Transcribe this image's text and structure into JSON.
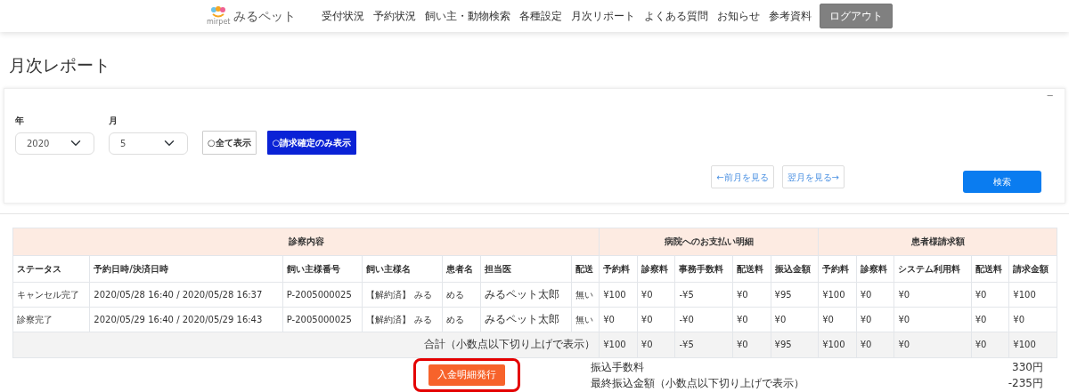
{
  "header": {
    "logo_text": "みるペット",
    "logo_sub": "mirpet",
    "nav": [
      {
        "label": "受付状況"
      },
      {
        "label": "予約状況"
      },
      {
        "label": "飼い主・動物検索"
      },
      {
        "label": "各種設定"
      },
      {
        "label": "月次リポート"
      },
      {
        "label": "よくある質問"
      },
      {
        "label": "お知らせ"
      },
      {
        "label": "参考資料"
      }
    ],
    "logout": "ログアウト"
  },
  "page_title": "月次レポート",
  "filter": {
    "collapse": "−",
    "year_label": "年",
    "year": "2020",
    "month_label": "月",
    "month": "5",
    "modes": [
      {
        "label": "○全て表示",
        "selected": false
      },
      {
        "label": "○請求確定のみ表示",
        "selected": true
      }
    ],
    "prev": "←前月を見る",
    "next": "翌月を見る→",
    "search": "検索"
  },
  "table": {
    "groups": [
      {
        "label": "診察内容"
      },
      {
        "label": "病院へのお支払い明細"
      },
      {
        "label": "患者様請求額"
      }
    ],
    "columns": [
      "ステータス",
      "予約日時/決済日時",
      "飼い主様番号",
      "飼い主様名",
      "患者名",
      "担当医",
      "配送",
      "予約料",
      "診察料",
      "事務手数料",
      "配送料",
      "振込金額",
      "予約料",
      "診察料",
      "システム利用料",
      "配送料",
      "請求金額"
    ],
    "rows": [
      [
        "キャンセル完了",
        "2020/05/28 16:40 / 2020/05/28 16:37",
        "P-2005000025",
        "【解約済】 みる",
        "める",
        "みるペット太郎",
        "無い",
        "¥100",
        "¥0",
        "-¥5",
        "¥0",
        "¥95",
        "¥100",
        "¥0",
        "¥0",
        "¥0",
        "¥100"
      ],
      [
        "診察完了",
        "2020/05/29 16:40 / 2020/05/29 16:43",
        "P-2005000025",
        "【解約済】 みる",
        "める",
        "みるペット太郎",
        "無い",
        "¥0",
        "¥0",
        "-¥0",
        "¥0",
        "¥0",
        "¥0",
        "¥0",
        "¥0",
        "¥0",
        "¥0"
      ]
    ],
    "total_label": "合計（小数点以下切り上げで表示）",
    "totals": [
      "¥100",
      "¥0",
      "-¥5",
      "¥0",
      "¥95",
      "¥100",
      "¥0",
      "¥0",
      "¥0",
      "¥100"
    ]
  },
  "issue_button": {
    "label": "入金明細発行",
    "highlighted": true
  },
  "summary": [
    {
      "label": "振込手数料",
      "value": "330円"
    },
    {
      "label": "最終振込金額（小数点以下切り上げで表示）",
      "value": "-235円"
    }
  ]
}
